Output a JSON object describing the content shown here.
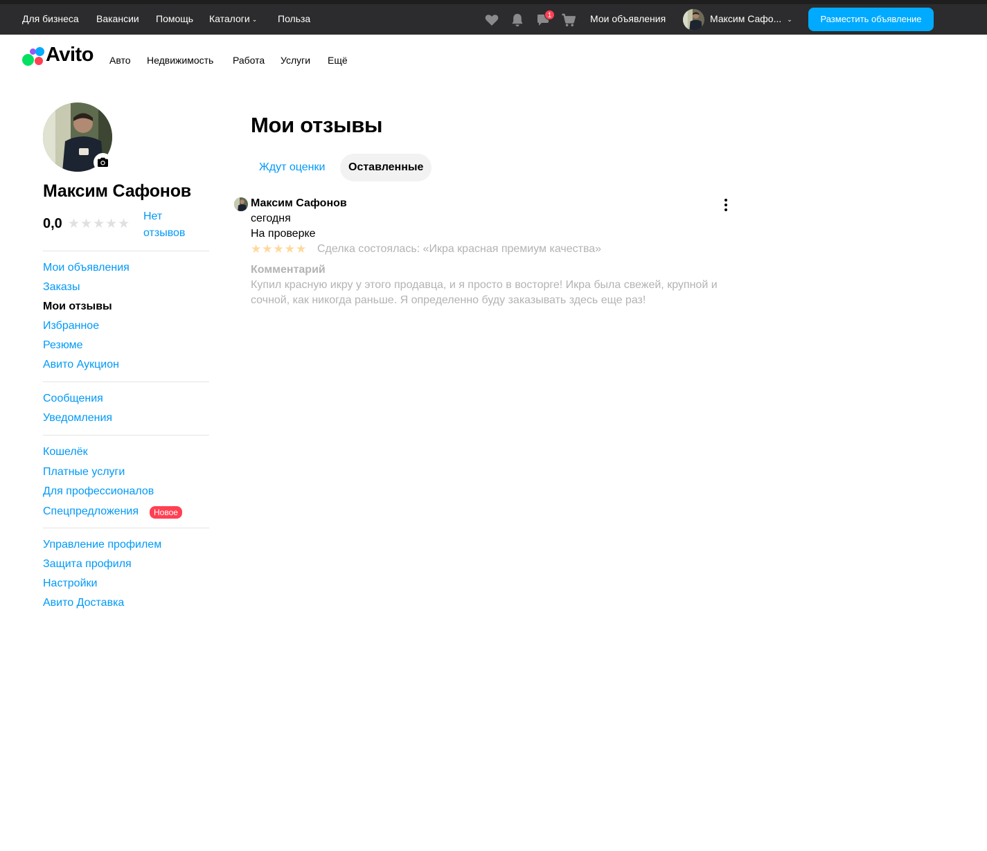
{
  "topbar": {
    "links": [
      "Для бизнеса",
      "Вакансии",
      "Помощь",
      "Каталоги",
      "Польза"
    ],
    "catalogs_chevron": "⌄",
    "icons": [
      "heart-icon",
      "bell-icon",
      "chat-icon",
      "cart-icon"
    ],
    "messages_badge": "1",
    "my_ads": "Мои объявления",
    "user_name": "Максим Сафо...",
    "user_chevron": "⌄",
    "post_button": "Разместить объявление"
  },
  "header": {
    "logo_text": "Avito",
    "nav": [
      "Авто",
      "Недвижимость",
      "Работа",
      "Услуги",
      "Ещё"
    ]
  },
  "sidebar": {
    "profile_name": "Максим Сафонов",
    "rating": "0,0",
    "rating_stars": "★★★★★",
    "no_reviews": "Нет отзывов",
    "group1": [
      "Мои объявления",
      "Заказы",
      "Мои отзывы",
      "Избранное",
      "Резюме",
      "Авито Аукцион"
    ],
    "group2": [
      "Сообщения",
      "Уведомления"
    ],
    "group3": [
      "Кошелёк",
      "Платные услуги",
      "Для профессионалов",
      "Спецпредложения"
    ],
    "new_badge": "Новое",
    "group4": [
      "Управление профилем",
      "Защита профиля",
      "Настройки",
      "Авито Доставка"
    ]
  },
  "main": {
    "title": "Мои отзывы",
    "tabs": [
      {
        "label": "Ждут оценки",
        "active": false
      },
      {
        "label": "Оставленные",
        "active": true
      }
    ],
    "review": {
      "author": "Максим Сафонов",
      "date": "сегодня",
      "status": "На проверке",
      "stars": "★★★★★",
      "deal": "Сделка состоялась: «Икра красная премиум качества»",
      "comment_label": "Комментарий",
      "comment": "Купил красную икру у этого продавца, и я просто в восторге! Икра была свежей, крупной и сочной, как никогда раньше. Я определенно буду заказывать здесь еще раз!"
    }
  },
  "colors": {
    "topbar_bg": "#2c2c2e",
    "accent_blue": "#00aaff",
    "link_blue": "#0099f7",
    "badge_red": "#ff4053",
    "star_filled": "#ffd89a",
    "star_empty": "#e0e0e0",
    "logo_dots": [
      "#9b55f4",
      "#0af",
      "#04e061",
      "#ff4053"
    ]
  }
}
